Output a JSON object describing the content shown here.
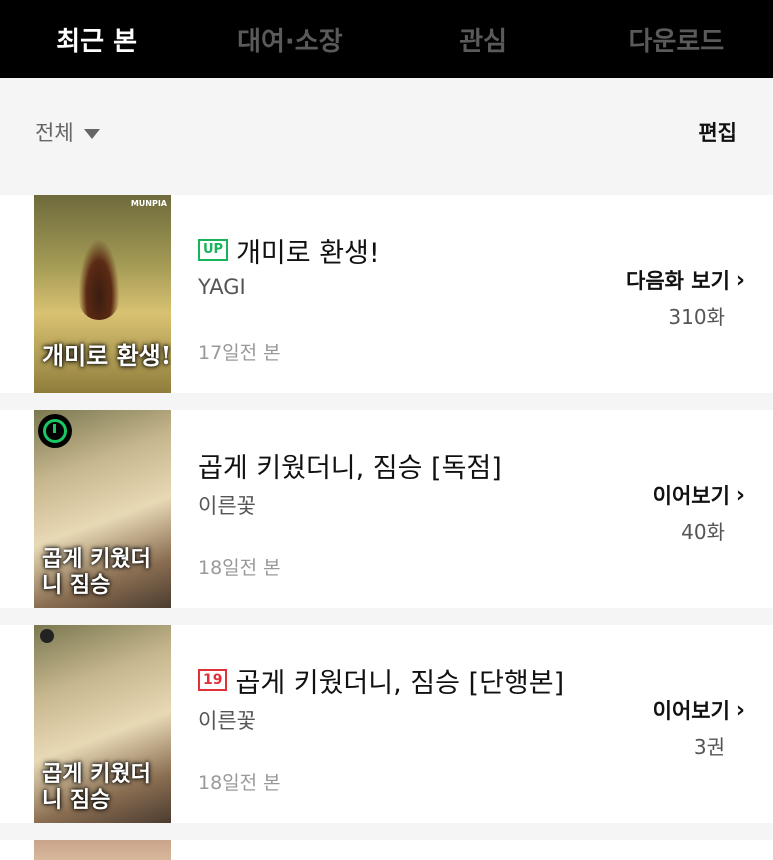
{
  "tabs": [
    {
      "label": "최근 본",
      "active": true
    },
    {
      "label": "대여·소장",
      "active": false
    },
    {
      "label": "관심",
      "active": false
    },
    {
      "label": "다운로드",
      "active": false
    }
  ],
  "filter": {
    "label": "전체",
    "edit_label": "편집"
  },
  "items": [
    {
      "badge": "UP",
      "title": "개미로 환생!",
      "author": "YAGI",
      "seen": "17일전 본",
      "action_label": "다음화 보기",
      "action_count": "310화",
      "cover_title": "개미로 환생!",
      "publisher": "MUNPIA"
    },
    {
      "badge": "",
      "title": "곱게 키웠더니, 짐승 [독점]",
      "author": "이른꽃",
      "seen": "18일전 본",
      "action_label": "이어보기",
      "action_count": "40화",
      "cover_title": "곱게 키웠더니 짐승"
    },
    {
      "badge": "19",
      "title": "곱게 키웠더니, 짐승 [단행본]",
      "author": "이른꽃",
      "seen": "18일전 본",
      "action_label": "이어보기",
      "action_count": "3권",
      "cover_title": "곱게 키웠더니 짐승"
    }
  ],
  "colors": {
    "up_badge": "#19b35a",
    "age_badge": "#e0303a",
    "timer": "#19c864"
  },
  "icons": {
    "filter": "caret-down-icon",
    "action": "chevron-right-icon",
    "item2": "timer-icon"
  }
}
